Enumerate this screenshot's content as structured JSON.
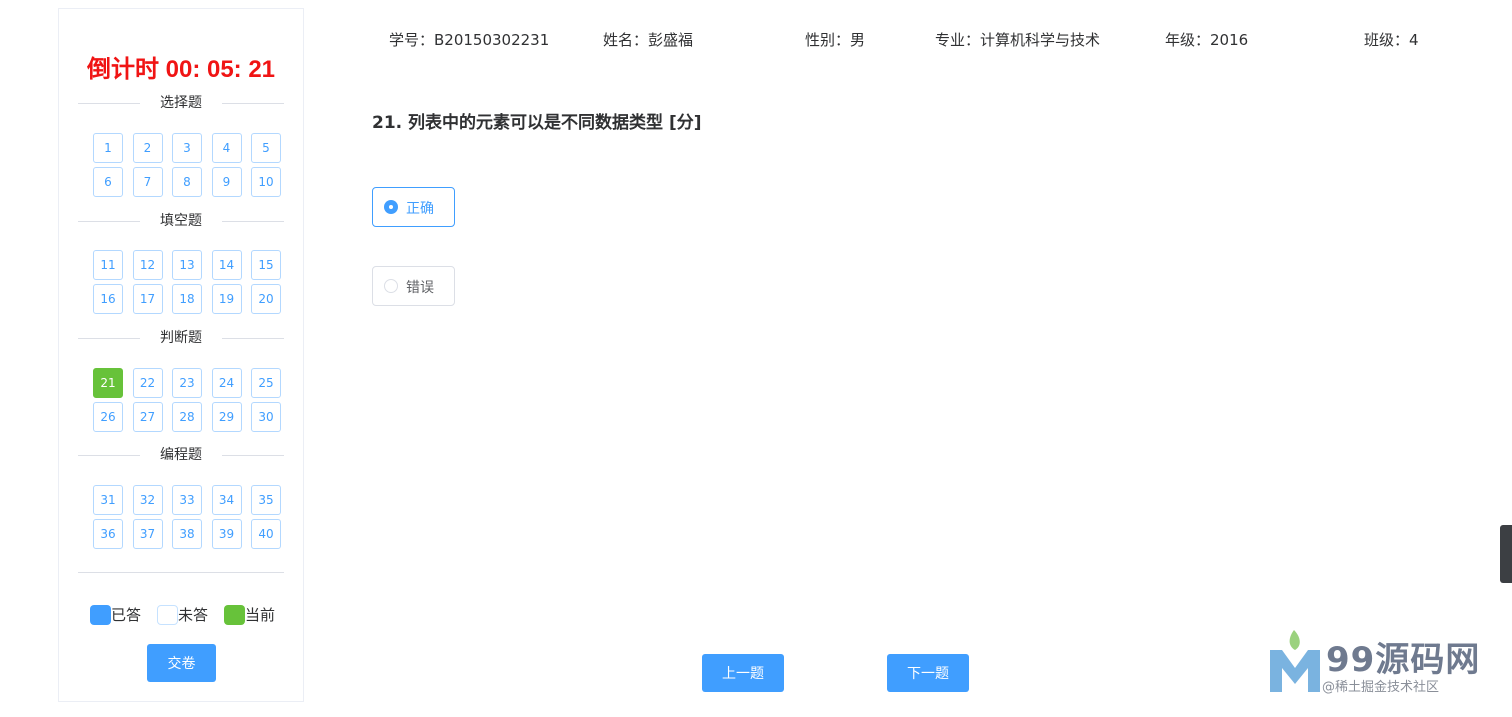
{
  "sidebar": {
    "countdown": "倒计时 00: 05: 21",
    "sections": [
      {
        "title": "选择题",
        "items": [
          "1",
          "2",
          "3",
          "4",
          "5",
          "6",
          "7",
          "8",
          "9",
          "10"
        ]
      },
      {
        "title": "填空题",
        "items": [
          "11",
          "12",
          "13",
          "14",
          "15",
          "16",
          "17",
          "18",
          "19",
          "20"
        ]
      },
      {
        "title": "判断题",
        "items": [
          "21",
          "22",
          "23",
          "24",
          "25",
          "26",
          "27",
          "28",
          "29",
          "30"
        ]
      },
      {
        "title": "编程题",
        "items": [
          "31",
          "32",
          "33",
          "34",
          "35",
          "36",
          "37",
          "38",
          "39",
          "40"
        ]
      }
    ],
    "current_question": "21",
    "legend": {
      "answered": "已答",
      "unanswered": "未答",
      "current": "当前"
    },
    "submit_label": "交卷"
  },
  "student_info": {
    "student_id": "学号：B20150302231",
    "name": "姓名：彭盛福",
    "gender": "性别：男",
    "major": "专业：计算机科学与技术",
    "grade": "年级：2016",
    "class": "班级：4"
  },
  "question": {
    "title": "21. 列表中的元素可以是不同数据类型 [分]",
    "options": [
      {
        "label": "正确",
        "selected": true
      },
      {
        "label": "错误",
        "selected": false
      }
    ]
  },
  "nav": {
    "prev_label": "上一题",
    "next_label": "下一题"
  },
  "watermark": {
    "brand": "99源码网",
    "sub": "@稀土掘金技术社区"
  },
  "colors": {
    "primary": "#409eff",
    "current": "#67c23a",
    "countdown": "#f01414"
  }
}
